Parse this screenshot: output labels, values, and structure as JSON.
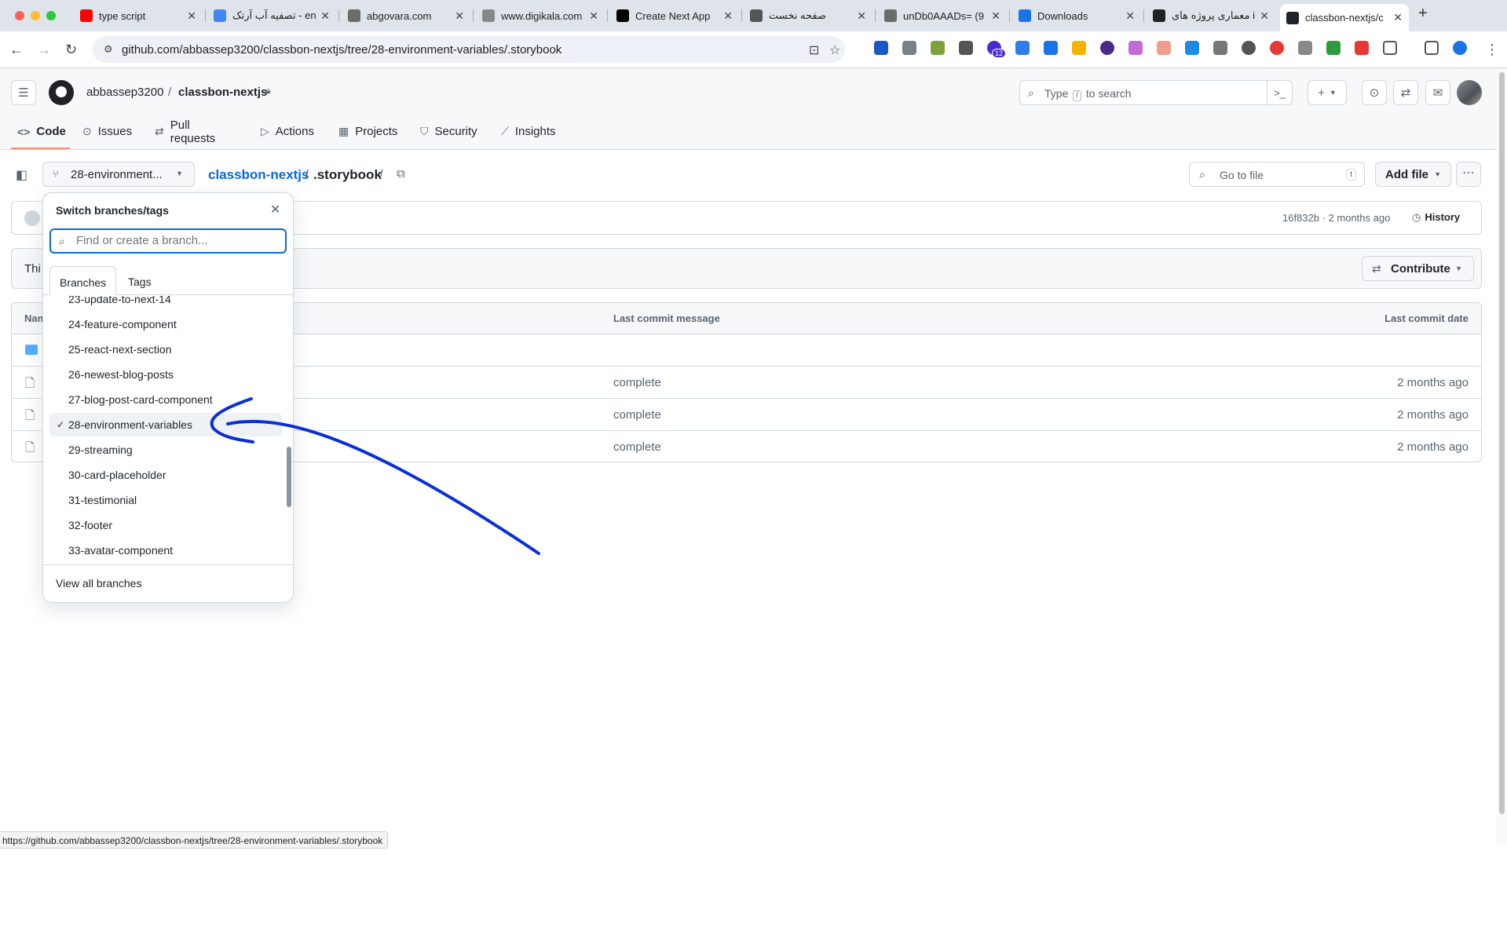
{
  "browser": {
    "tabs": [
      {
        "title": "type script",
        "icon": "youtube-icon",
        "color": "#ff0000"
      },
      {
        "title": "تصفیه آب آرتک - en",
        "icon": "google-icon",
        "color": "#4285f4"
      },
      {
        "title": "abgovara.com",
        "icon": "globe-icon",
        "color": "#6b6b6b"
      },
      {
        "title": "www.digikala.com",
        "icon": "page-icon",
        "color": "#888888"
      },
      {
        "title": "Create Next App",
        "icon": "vercel-icon",
        "color": "#000000"
      },
      {
        "title": "صفحه نخست",
        "icon": "diamond-icon",
        "color": "#555555"
      },
      {
        "title": "unDb0AAADs= (9",
        "icon": "globe-icon",
        "color": "#6b6b6b"
      },
      {
        "title": "Downloads",
        "icon": "download-icon",
        "color": "#1a73e8"
      },
      {
        "title": "معماری پروژه های ile",
        "icon": "sid-icon",
        "color": "#222222"
      },
      {
        "title": "classbon-nextjs/c",
        "icon": "github-icon",
        "color": "#1f2328"
      }
    ],
    "url": "github.com/abbassep3200/classbon-nextjs/tree/28-environment-variables/.storybook",
    "extensions_badge": "12",
    "status_url": "https://github.com/abbassep3200/classbon-nextjs/tree/28-environment-variables/.storybook"
  },
  "header": {
    "owner": "abbassep3200",
    "separator": "/",
    "repo": "classbon-nextjs",
    "search_placeholder_pre": "Type",
    "search_key": "/",
    "search_placeholder_post": "to search",
    "plus_label": "+"
  },
  "repo_nav": [
    {
      "label": "Code",
      "icon": "code-icon"
    },
    {
      "label": "Issues",
      "icon": "issues-icon"
    },
    {
      "label": "Pull requests",
      "icon": "pull-request-icon"
    },
    {
      "label": "Actions",
      "icon": "actions-icon"
    },
    {
      "label": "Projects",
      "icon": "projects-icon"
    },
    {
      "label": "Security",
      "icon": "shield-icon"
    },
    {
      "label": "Insights",
      "icon": "graph-icon"
    }
  ],
  "content": {
    "branch_button": "28-environment...",
    "path_repo": "classbon-nextjs",
    "path_sep": "/",
    "path_dir": ".storybook",
    "goto_placeholder": "Go to file",
    "goto_key": "t",
    "add_file": "Add file",
    "commit_hash_time": "16f832b · 2 months ago",
    "history": "History",
    "notice_prefix": "Thi",
    "contribute": "Contribute",
    "table_headers": {
      "name": "Nam",
      "message": "Last commit message",
      "date": "Last commit date"
    },
    "rows": [
      {
        "type": "folder",
        "message": "",
        "date": ""
      },
      {
        "type": "file",
        "message": "complete",
        "date": "2 months ago"
      },
      {
        "type": "file",
        "message": "complete",
        "date": "2 months ago"
      },
      {
        "type": "file",
        "message": "complete",
        "date": "2 months ago"
      }
    ]
  },
  "dropdown": {
    "title": "Switch branches/tags",
    "filter_placeholder": "Find or create a branch...",
    "tabs": [
      "Branches",
      "Tags"
    ],
    "branches": [
      {
        "name": "23-update-to-next-14",
        "selected": false
      },
      {
        "name": "24-feature-component",
        "selected": false
      },
      {
        "name": "25-react-next-section",
        "selected": false
      },
      {
        "name": "26-newest-blog-posts",
        "selected": false
      },
      {
        "name": "27-blog-post-card-component",
        "selected": false
      },
      {
        "name": "28-environment-variables",
        "selected": true
      },
      {
        "name": "29-streaming",
        "selected": false
      },
      {
        "name": "30-card-placeholder",
        "selected": false
      },
      {
        "name": "31-testimonial",
        "selected": false
      },
      {
        "name": "32-footer",
        "selected": false
      },
      {
        "name": "33-avatar-component",
        "selected": false
      }
    ],
    "check_glyph": "✓",
    "view_all": "View all branches"
  },
  "colors": {
    "accent": "#0969da",
    "nav_underline": "#fd8c73",
    "annotation_stroke": "#0a2fd6"
  }
}
